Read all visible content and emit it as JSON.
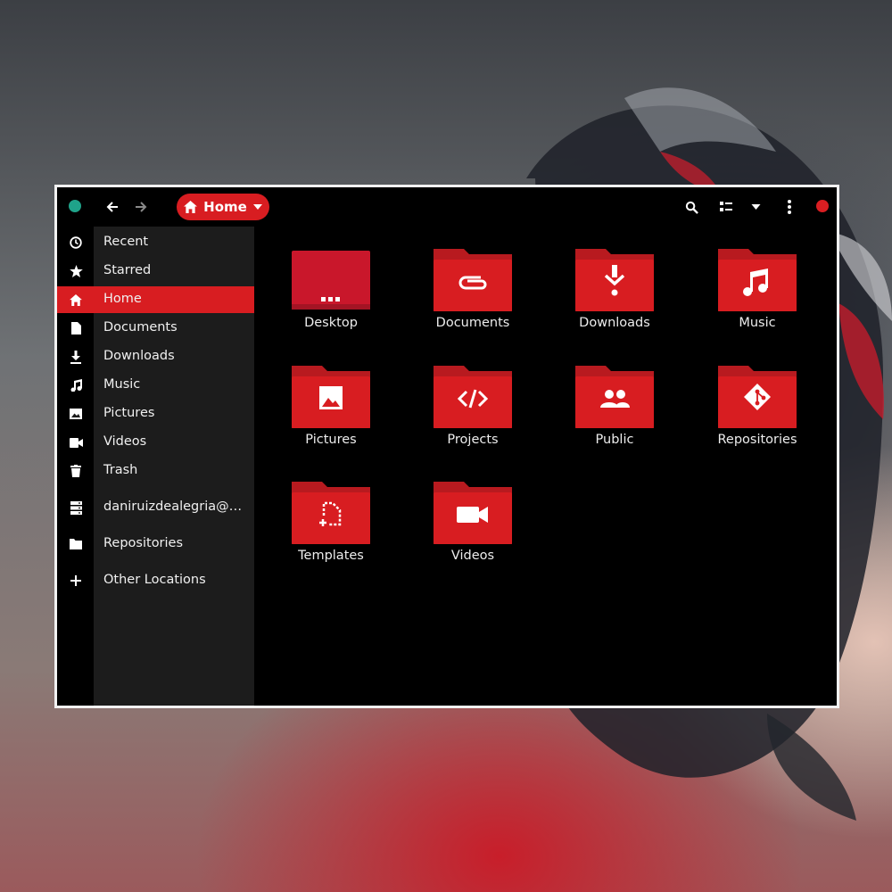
{
  "colors": {
    "accent": "#d81d21",
    "folder_tab": "#b81a1f",
    "window_bg": "#000000",
    "sidebar_bg": "#1c1c1c",
    "green_dot": "#1fa38a",
    "red_dot": "#d91e22"
  },
  "headerbar": {
    "path_label": "Home",
    "path_icon": "home-icon",
    "icons": [
      "back-arrow-icon",
      "forward-arrow-icon",
      "search-icon",
      "view-options-icon",
      "chevron-down-icon",
      "menu-dots-icon"
    ]
  },
  "sidebar": {
    "items": [
      {
        "label": "Recent",
        "icon": "clock-icon"
      },
      {
        "label": "Starred",
        "icon": "star-icon"
      },
      {
        "label": "Home",
        "icon": "home-icon",
        "active": true
      },
      {
        "label": "Documents",
        "icon": "document-icon"
      },
      {
        "label": "Downloads",
        "icon": "download-icon"
      },
      {
        "label": "Music",
        "icon": "music-note-icon"
      },
      {
        "label": "Pictures",
        "icon": "image-icon"
      },
      {
        "label": "Videos",
        "icon": "video-camera-icon"
      },
      {
        "label": "Trash",
        "icon": "trash-icon"
      },
      {
        "label": "daniruizdealegria@…",
        "icon": "server-icon"
      },
      {
        "label": "Repositories",
        "icon": "folder-icon"
      },
      {
        "label": "Other Locations",
        "icon": "plus-icon"
      }
    ]
  },
  "files": [
    {
      "label": "Desktop",
      "icon": "desktop-folder-icon"
    },
    {
      "label": "Documents",
      "icon": "paperclip-folder-icon"
    },
    {
      "label": "Downloads",
      "icon": "download-folder-icon"
    },
    {
      "label": "Music",
      "icon": "music-folder-icon"
    },
    {
      "label": "Pictures",
      "icon": "image-folder-icon"
    },
    {
      "label": "Projects",
      "icon": "code-folder-icon"
    },
    {
      "label": "Public",
      "icon": "people-folder-icon"
    },
    {
      "label": "Repositories",
      "icon": "git-folder-icon"
    },
    {
      "label": "Templates",
      "icon": "template-folder-icon"
    },
    {
      "label": "Videos",
      "icon": "video-folder-icon"
    }
  ]
}
